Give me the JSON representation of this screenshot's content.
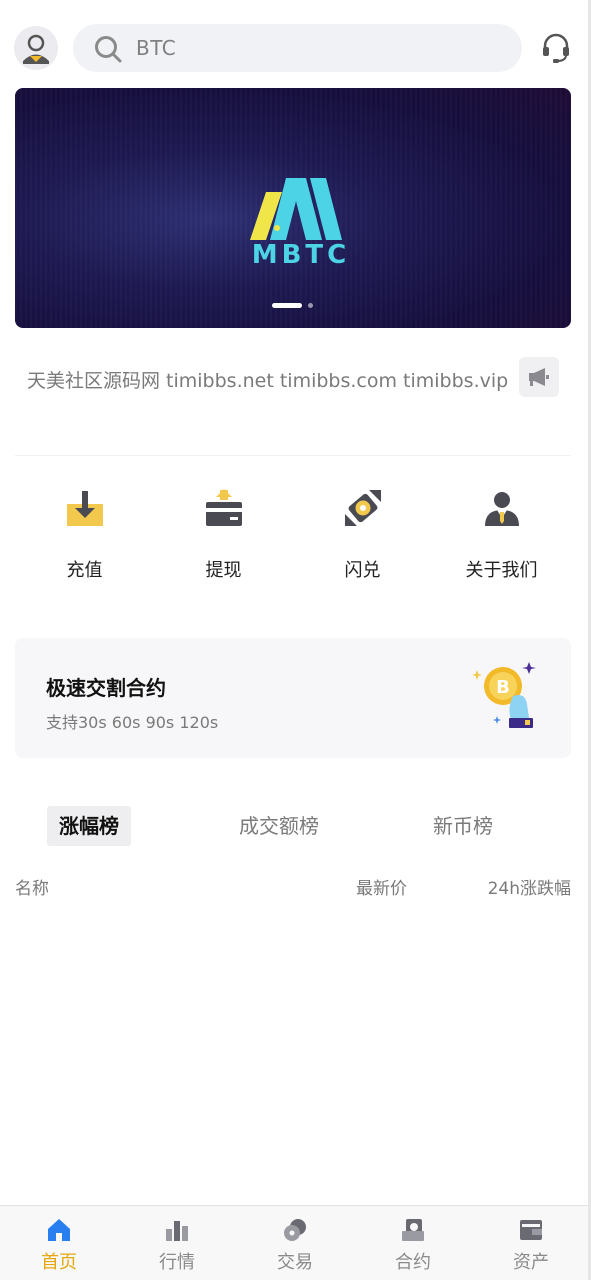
{
  "header": {
    "search_placeholder": "BTC"
  },
  "banner": {
    "logo_text": "MBTC",
    "slide_count": 2,
    "active_slide": 1
  },
  "notice": {
    "text": "天美社区源码网 timibbs.net timibbs.com timibbs.vip"
  },
  "actions": [
    {
      "label": "充值",
      "icon": "deposit-icon"
    },
    {
      "label": "提现",
      "icon": "withdraw-icon"
    },
    {
      "label": "闪兑",
      "icon": "flash-swap-icon"
    },
    {
      "label": "关于我们",
      "icon": "about-us-icon"
    }
  ],
  "promo": {
    "title": "极速交割合约",
    "subtitle": "支持30s 60s 90s 120s"
  },
  "tabs": [
    {
      "label": "涨幅榜",
      "active": true
    },
    {
      "label": "成交额榜",
      "active": false
    },
    {
      "label": "新币榜",
      "active": false
    }
  ],
  "list_header": {
    "name": "名称",
    "price": "最新价",
    "change": "24h涨跌幅"
  },
  "bottom_nav": [
    {
      "label": "首页",
      "icon": "home-icon",
      "active": true
    },
    {
      "label": "行情",
      "icon": "market-icon",
      "active": false
    },
    {
      "label": "交易",
      "icon": "trade-icon",
      "active": false
    },
    {
      "label": "合约",
      "icon": "contract-icon",
      "active": false
    },
    {
      "label": "资产",
      "icon": "wallet-icon",
      "active": false
    }
  ],
  "colors": {
    "accent": "#e5a712",
    "icon_yellow": "#f2c94c",
    "icon_dark": "#4a4a52",
    "banner_cyan": "#4dd3e6",
    "nav_active_blue": "#2a7ff0"
  }
}
